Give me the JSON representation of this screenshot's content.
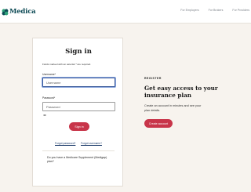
{
  "header": {
    "brand": "Medica",
    "links": [
      "For Employers",
      "For Brokers",
      "For Providers"
    ]
  },
  "login": {
    "title": "Sign in",
    "required_note": "Fields marked with an asterisk * are required.",
    "username_label": "Username*",
    "username_placeholder": "Username",
    "password_label": "Password*",
    "password_placeholder": "Password",
    "signin_label": "Sign in",
    "forgot_password": "Forgot password?",
    "forgot_username": "Forgot username?",
    "medigap_text": "Do you have a Medicare Supplement (Medigap) plan?"
  },
  "register": {
    "eyebrow": "REGISTER",
    "title": "Get easy access to your insurance plan",
    "body": "Create an account in minutes and see your plan details.",
    "button_label": "Create account"
  },
  "colors": {
    "brand_teal": "#0d4a55",
    "brand_green": "#2fa37a",
    "accent_red": "#c8354a",
    "page_bg": "#f7f3ee"
  }
}
